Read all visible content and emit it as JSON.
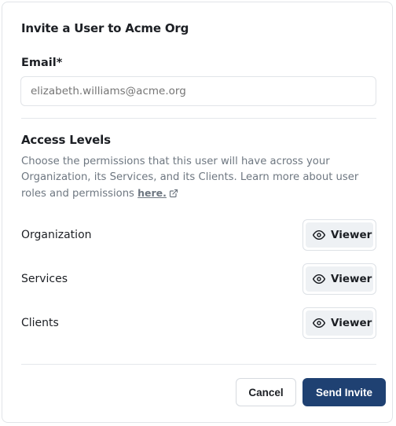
{
  "modal": {
    "title": "Invite a User to Acme Org",
    "email": {
      "label": "Email*",
      "placeholder": "elizabeth.williams@acme.org",
      "value": ""
    },
    "access": {
      "title": "Access Levels",
      "description": "Choose the permissions that this user will have across your Organization, its Services, and its Clients. Learn more about user roles and permissions",
      "link_text": "here.",
      "rows": [
        {
          "label": "Organization",
          "role": "Viewer"
        },
        {
          "label": "Services",
          "role": "Viewer"
        },
        {
          "label": "Clients",
          "role": "Viewer"
        }
      ]
    },
    "footer": {
      "cancel_label": "Cancel",
      "submit_label": "Send Invite"
    }
  },
  "colors": {
    "primary": "#1f4172",
    "border": "#e1e4e8",
    "muted_text": "#6e7781",
    "role_bg": "#eef1f4"
  },
  "icons": {
    "external_link": "external-link-icon",
    "role": "eye-icon"
  }
}
